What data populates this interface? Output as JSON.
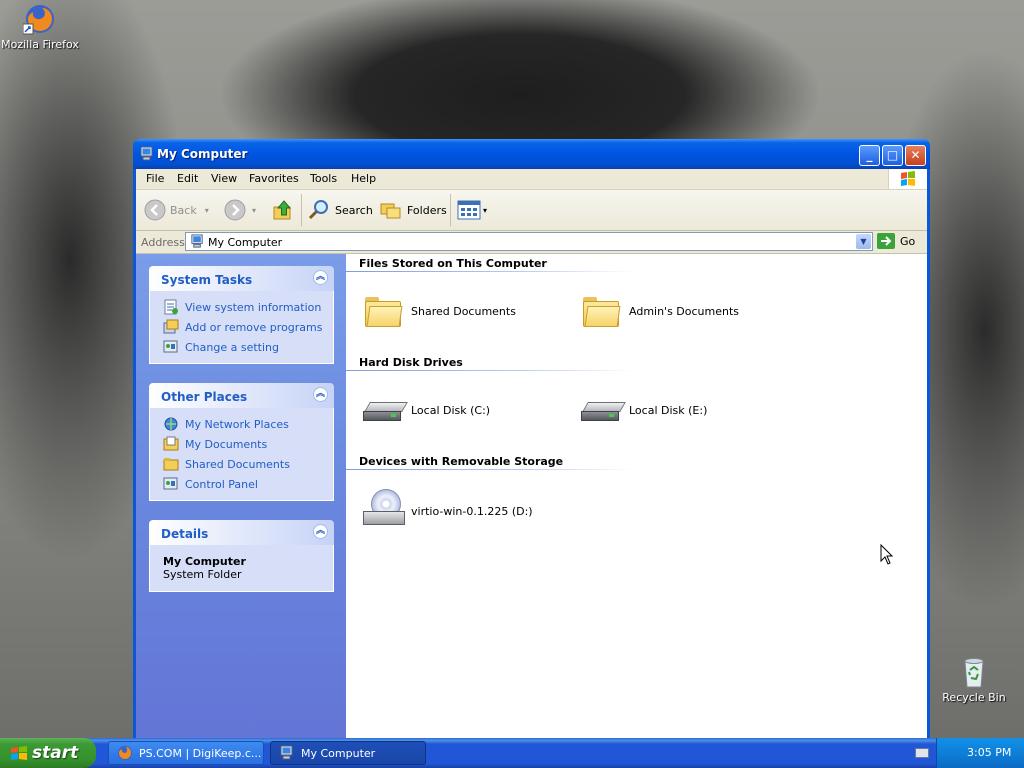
{
  "desktop": {
    "icons": [
      {
        "label": "Mozilla Firefox"
      },
      {
        "label": "Recycle Bin"
      }
    ]
  },
  "window": {
    "title": "My Computer",
    "controls": {
      "minimize": "_",
      "maximize": "□",
      "close": "✕"
    }
  },
  "menubar": {
    "items": [
      "File",
      "Edit",
      "View",
      "Favorites",
      "Tools",
      "Help"
    ]
  },
  "toolbar": {
    "back": "Back",
    "search": "Search",
    "folders": "Folders"
  },
  "address": {
    "label": "Address",
    "value": "My Computer",
    "go": "Go"
  },
  "leftpane": {
    "system_tasks": {
      "title": "System Tasks",
      "items": [
        "View system information",
        "Add or remove programs",
        "Change a setting"
      ]
    },
    "other_places": {
      "title": "Other Places",
      "items": [
        "My Network Places",
        "My Documents",
        "Shared Documents",
        "Control Panel"
      ]
    },
    "details": {
      "title": "Details",
      "name": "My Computer",
      "type": "System Folder"
    }
  },
  "content": {
    "groups": [
      {
        "title": "Files Stored on This Computer",
        "items": [
          "Shared Documents",
          "Admin's Documents"
        ]
      },
      {
        "title": "Hard Disk Drives",
        "items": [
          "Local Disk (C:)",
          "Local Disk (E:)"
        ]
      },
      {
        "title": "Devices with Removable Storage",
        "items": [
          "virtio-win-0.1.225 (D:)"
        ]
      }
    ]
  },
  "taskbar": {
    "start": "start",
    "tasks": [
      "PS.COM | DigiKeep.c...",
      "My Computer"
    ],
    "clock": "3:05 PM"
  },
  "colors": {
    "title_blue": "#0054e3",
    "task_link": "#215dc6",
    "start_green": "#3c9a34",
    "tray_blue": "#0e7fd8"
  }
}
